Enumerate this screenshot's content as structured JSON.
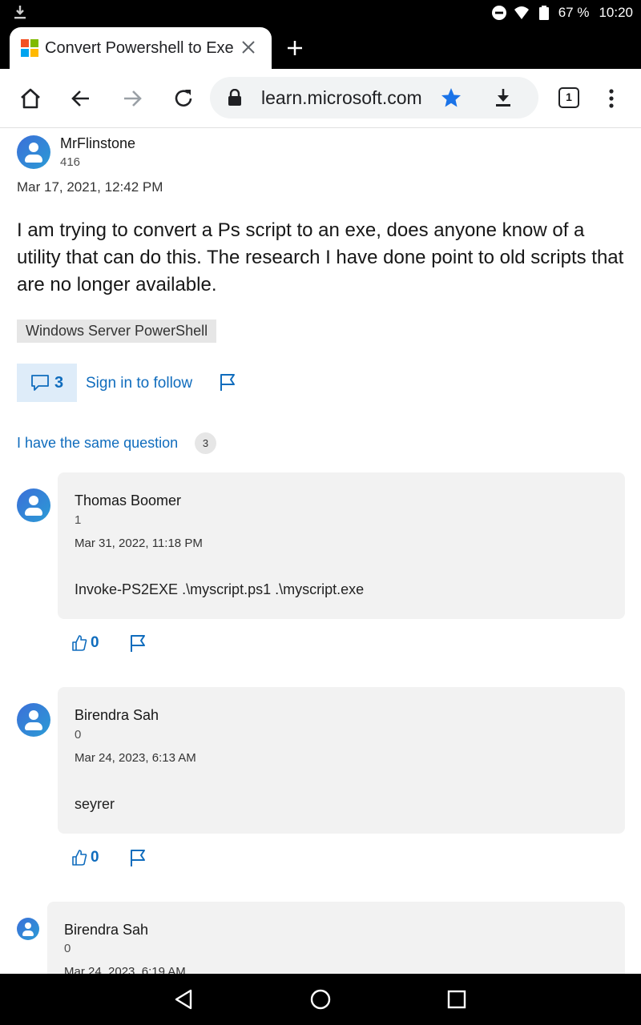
{
  "status_bar": {
    "battery": "67 %",
    "time": "10:20"
  },
  "tab": {
    "title": "Convert Powershell to Exe"
  },
  "toolbar": {
    "url": "learn.microsoft.com",
    "tab_count": "1"
  },
  "question": {
    "author": "MrFlinstone",
    "reputation": "416",
    "date": "Mar 17, 2021, 12:42 PM",
    "body": "I am trying to convert a Ps script to an exe, does anyone know of a utility that can do this. The research I have done point to old scripts that are no longer available.",
    "tag": "Windows Server PowerShell",
    "comment_count": "3",
    "follow_label": "Sign in to follow",
    "same_question_label": "I have the same question",
    "same_question_count": "3"
  },
  "answers": [
    {
      "author": "Thomas Boomer",
      "reputation": "1",
      "date": "Mar 31, 2022, 11:18 PM",
      "body": "Invoke-PS2EXE .\\myscript.ps1 .\\myscript.exe",
      "votes": "0"
    },
    {
      "author": "Birendra Sah",
      "reputation": "0",
      "date": "Mar 24, 2023, 6:13 AM",
      "body": "seyrer",
      "votes": "0"
    },
    {
      "author": "Birendra Sah",
      "reputation": "0",
      "date": "Mar 24, 2023, 6:19 AM"
    }
  ],
  "colors": {
    "link": "#0f6cbd",
    "card_bg": "#f2f2f2",
    "accent_star": "#1a73e8"
  }
}
